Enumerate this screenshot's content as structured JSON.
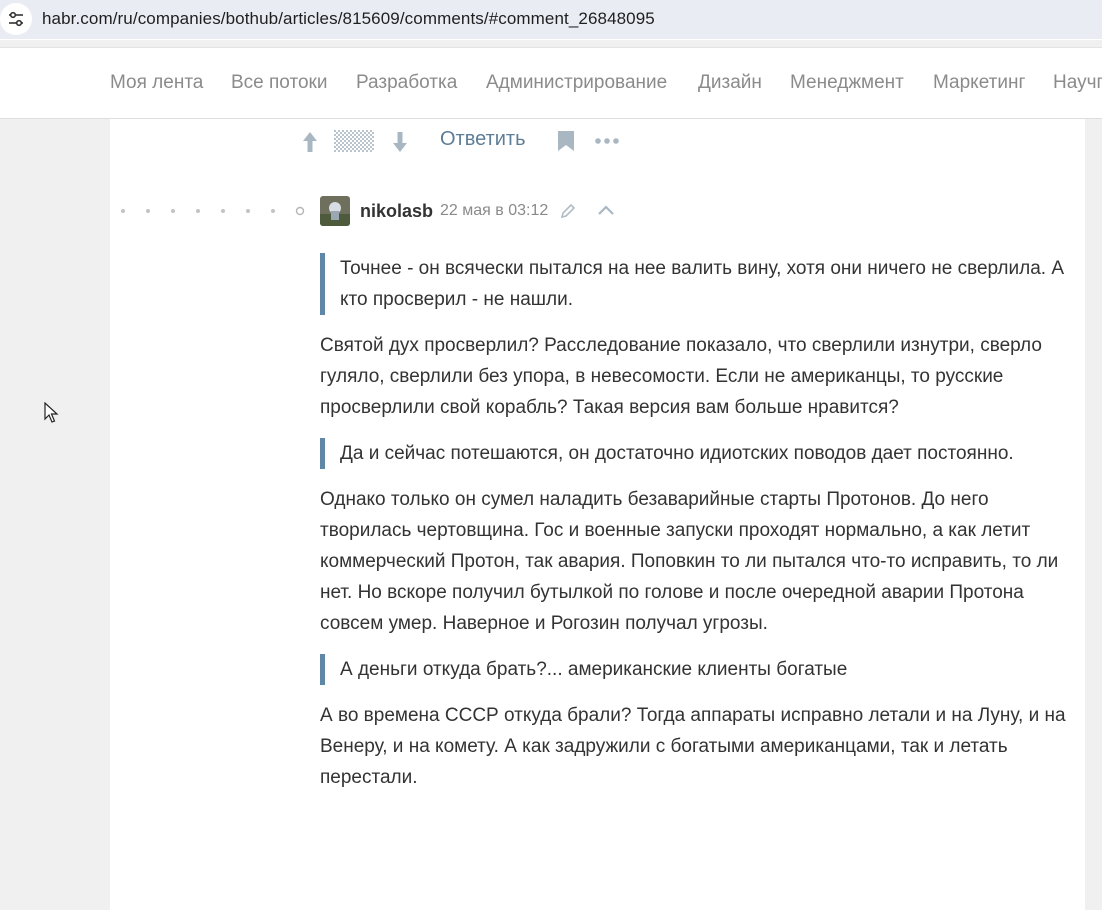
{
  "browser": {
    "url": "habr.com/ru/companies/bothub/articles/815609/comments/#comment_26848095",
    "site_info_icon": "tune-icon"
  },
  "nav": {
    "items": [
      "Моя лента",
      "Все потоки",
      "Разработка",
      "Администрирование",
      "Дизайн",
      "Менеджмент",
      "Маркетинг",
      "Научп"
    ]
  },
  "actions": {
    "reply_label": "Ответить",
    "icons": [
      "arrow-up-icon",
      "score-hidden-icon",
      "arrow-down-icon",
      "bookmark-icon",
      "more-icon"
    ]
  },
  "comment": {
    "username": "nikolasb",
    "timestamp": "22 мая в 03:12",
    "blocks": [
      {
        "type": "quote",
        "text": "Точнее - он всячески пытался на нее валить вину, хотя они ничего не сверлила. А кто просверил - не нашли."
      },
      {
        "type": "para",
        "text": "Святой дух просверлил? Расследование показало, что сверлили изнутри, сверло гуляло, сверлили без упора, в невесомости. Если не американцы, то русские просверлили свой корабль? Такая версия вам больше нравится?"
      },
      {
        "type": "quote",
        "text": "Да и сейчас потешаются, он достаточно идиотских поводов дает постоянно."
      },
      {
        "type": "para",
        "text": "Однако только он сумел наладить безаварийные старты Протонов. До него творилась чертовщина. Гос и военные запуски проходят нормально, а как летит коммерческий Протон, так авария. Поповкин то ли пытался что-то исправить, то ли нет. Но вскоре получил бутылкой по голове и после очередной аварии Протона совсем умер. Наверное и Рогозин получал угрозы."
      },
      {
        "type": "quote",
        "text": "А деньги откуда брать?... американские клиенты богатые"
      },
      {
        "type": "para",
        "text": "А во времена СССР откуда брали? Тогда аппараты исправно летали и на Луну, и на Венеру, и на комету. А как задружили с богатыми американцами, так и летать перестали."
      }
    ]
  },
  "colors": {
    "quote_border": "#5f87a6",
    "link": "#5e7d96",
    "nav_text": "#8b8b8b",
    "page_bg": "#f0f0f0"
  }
}
